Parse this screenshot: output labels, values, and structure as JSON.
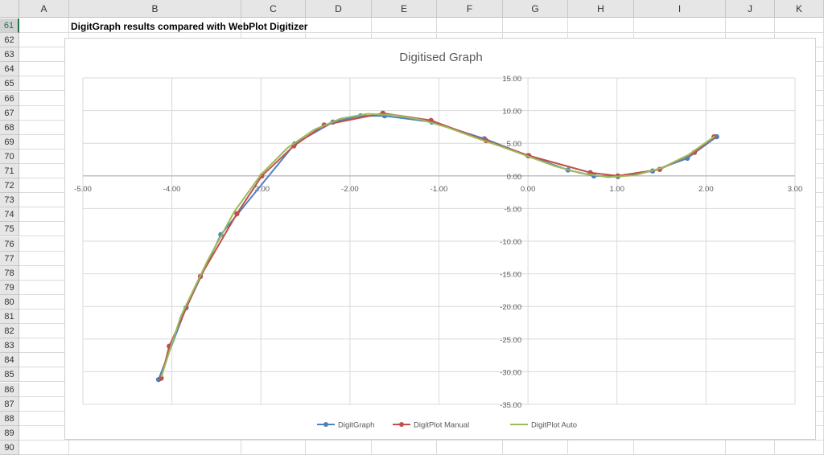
{
  "sheet": {
    "columns": [
      "A",
      "B",
      "C",
      "D",
      "E",
      "F",
      "G",
      "H",
      "I",
      "J",
      "K"
    ],
    "rows": [
      "61",
      "62",
      "63",
      "64",
      "65",
      "66",
      "67",
      "68",
      "69",
      "70",
      "71",
      "72",
      "73",
      "74",
      "75",
      "76",
      "77",
      "78",
      "79",
      "80",
      "81",
      "82",
      "83",
      "84",
      "85",
      "86",
      "87",
      "88",
      "89",
      "90"
    ],
    "active_row": "61",
    "cell_B61": "DigitGraph results compared with WebPlot Digitizer"
  },
  "chart_data": {
    "type": "scatter",
    "title": "Digitised Graph",
    "xlim": [
      -5,
      3
    ],
    "ylim": [
      -35,
      15
    ],
    "xticks": [
      -5,
      -4,
      -3,
      -2,
      -1,
      0,
      1,
      2,
      3
    ],
    "yticks": [
      15,
      10,
      5,
      0,
      -5,
      -10,
      -15,
      -20,
      -25,
      -30,
      -35
    ],
    "grid": true,
    "legend": "bottom",
    "series": [
      {
        "name": "DigitGraph",
        "color": "#4f81bd",
        "markers": true,
        "x": [
          -4.15,
          -3.84,
          -3.45,
          -2.62,
          -2.19,
          -1.88,
          -1.61,
          -1.08,
          -0.49,
          0,
          0.45,
          0.74,
          1.01,
          1.4,
          1.79,
          2.12
        ],
        "y": [
          -31.2,
          -20.2,
          -9.0,
          4.9,
          8.25,
          9.2,
          9.2,
          8.25,
          5.7,
          3.1,
          0.9,
          0.0,
          -0.1,
          0.75,
          2.7,
          6.0
        ]
      },
      {
        "name": "DigitPlot Manual",
        "color": "#c0504d",
        "markers": true,
        "x": [
          -4.12,
          -4.03,
          -3.68,
          -3.27,
          -2.99,
          -2.63,
          -2.29,
          -1.63,
          -1.09,
          -0.47,
          0.01,
          0.7,
          1.01,
          1.48,
          1.87,
          2.09
        ],
        "y": [
          -31.0,
          -26.1,
          -15.4,
          -5.8,
          0.0,
          4.6,
          7.8,
          9.6,
          8.5,
          5.4,
          3.1,
          0.5,
          0.0,
          1.0,
          3.6,
          6.0
        ]
      },
      {
        "name": "DigitPlot Auto",
        "color": "#9bbb59",
        "markers": false,
        "x": [
          -4.12,
          -3.9,
          -3.6,
          -3.3,
          -3.0,
          -2.7,
          -2.4,
          -2.1,
          -1.8,
          -1.5,
          -1.2,
          -0.9,
          -0.6,
          -0.3,
          0,
          0.3,
          0.6,
          0.9,
          1.2,
          1.5,
          1.8,
          2.1
        ],
        "y": [
          -30.8,
          -21.5,
          -13.0,
          -5.5,
          0.2,
          4.3,
          7.1,
          8.8,
          9.5,
          9.3,
          8.6,
          7.4,
          5.9,
          4.5,
          3.0,
          1.5,
          0.4,
          -0.2,
          0.1,
          1.2,
          3.2,
          6.1
        ]
      }
    ]
  }
}
